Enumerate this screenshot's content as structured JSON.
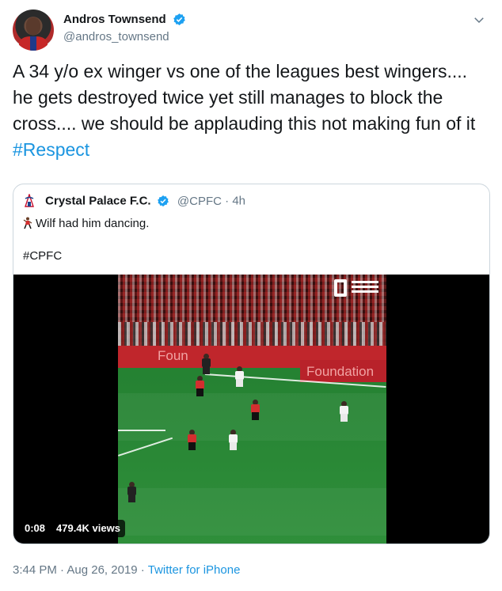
{
  "author": {
    "display_name": "Andros Townsend",
    "handle": "@andros_townsend"
  },
  "tweet": {
    "text": "A 34 y/o ex winger vs one of the leagues best wingers.... he gets destroyed twice yet still manages to block the cross.... we should be applauding this not making fun of it ",
    "hashtag": "#Respect"
  },
  "quoted": {
    "display_name": "Crystal Palace F.C.",
    "handle": "@CPFC",
    "separator": "·",
    "time": "4h",
    "text": "Wilf had him dancing.",
    "hashtag_line": "#CPFC",
    "video": {
      "duration": "0:08",
      "views": "479.4K views",
      "hoarding_left": "Foun",
      "hoarding_right": "Foundation"
    }
  },
  "footer": {
    "time": "3:44 PM",
    "separator1": " · ",
    "date": "Aug 26, 2019",
    "separator2": " · ",
    "source": "Twitter for iPhone"
  },
  "colors": {
    "link": "#1b95e0",
    "muted": "#657786",
    "text": "#14171a",
    "verified": "#1da1f2"
  },
  "icons": [
    "verified-icon",
    "chevron-down-icon",
    "crystal-palace-logo-icon",
    "dancer-emoji-icon"
  ]
}
